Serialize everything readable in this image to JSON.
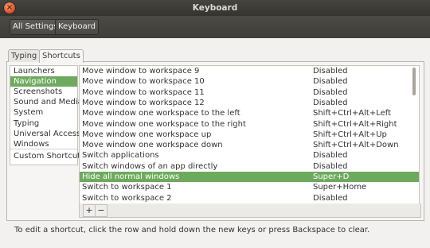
{
  "window": {
    "title": "Keyboard"
  },
  "toolbar": {
    "all_settings": "All Settings",
    "keyboard": "Keyboard"
  },
  "tabs": [
    {
      "label": "Typing"
    },
    {
      "label": "Shortcuts",
      "active": true
    }
  ],
  "categories": [
    "Launchers",
    "Navigation",
    "Screenshots",
    "Sound and Media",
    "System",
    "Typing",
    "Universal Access",
    "Windows",
    "Custom Shortcuts"
  ],
  "selected_category": "Navigation",
  "shortcuts": [
    {
      "name": "Move window to workspace 9",
      "key": "Disabled"
    },
    {
      "name": "Move window to workspace 10",
      "key": "Disabled"
    },
    {
      "name": "Move window to workspace 11",
      "key": "Disabled"
    },
    {
      "name": "Move window to workspace 12",
      "key": "Disabled"
    },
    {
      "name": "Move window one workspace to the left",
      "key": "Shift+Ctrl+Alt+Left"
    },
    {
      "name": "Move window one workspace to the right",
      "key": "Shift+Ctrl+Alt+Right"
    },
    {
      "name": "Move window one workspace up",
      "key": "Shift+Ctrl+Alt+Up"
    },
    {
      "name": "Move window one workspace down",
      "key": "Shift+Ctrl+Alt+Down"
    },
    {
      "name": "Switch applications",
      "key": "Disabled"
    },
    {
      "name": "Switch windows of an app directly",
      "key": "Disabled"
    },
    {
      "name": "Hide all normal windows",
      "key": "Super+D",
      "selected": true
    },
    {
      "name": "Switch to workspace 1",
      "key": "Super+Home"
    },
    {
      "name": "Switch to workspace 2",
      "key": "Disabled"
    }
  ],
  "buttons": {
    "add": "+",
    "remove": "−"
  },
  "hint": "To edit a shortcut, click the row and hold down the new keys or press Backspace to clear.",
  "colors": {
    "selection": "#6eaa5e",
    "titlebar": "#3c3b37"
  }
}
